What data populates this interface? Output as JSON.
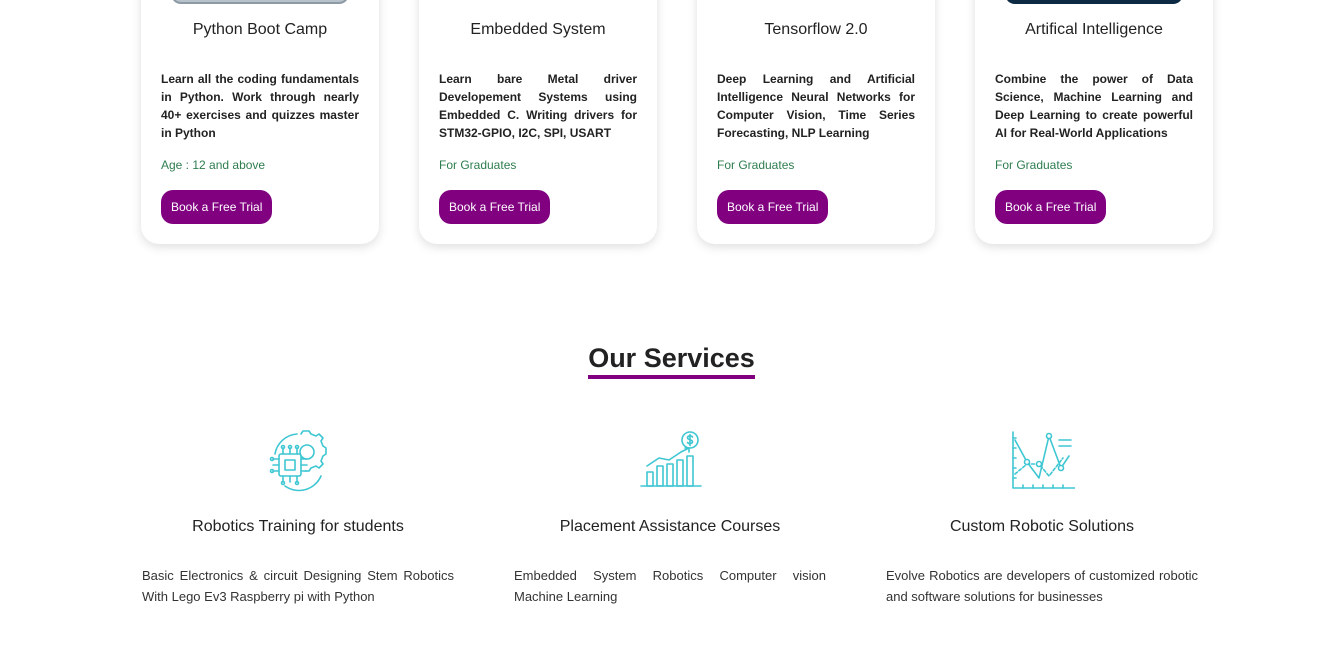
{
  "courses": [
    {
      "title": "Python Boot Camp",
      "description": "Learn all the coding fundamentals in Python. Work through nearly 40+ exercises and quizzes master in Python",
      "meta": "Age : 12 and above",
      "button": "Book a Free Trial",
      "image_color": "#b8c2cc"
    },
    {
      "title": "Embedded System",
      "description": "Learn bare Metal driver Developement Systems using Embedded C. Writing drivers for STM32-GPIO, I2C, SPI, USART",
      "meta": "For Graduates",
      "button": "Book a Free Trial",
      "image_color": "#ffffff"
    },
    {
      "title": "Tensorflow 2.0",
      "description": "Deep Learning and Artificial Intelligence Neural Networks for Computer Vision, Time Series Forecasting, NLP Learning",
      "meta": "For Graduates",
      "button": "Book a Free Trial",
      "image_color": "#ffffff"
    },
    {
      "title": "Artifical Intelligence",
      "description": "Combine the power of Data Science, Machine Learning and Deep Learning to create powerful AI for Real-World Applications",
      "meta": "For Graduates",
      "button": "Book a Free Trial",
      "image_color": "#0d2a44"
    }
  ],
  "services_section": {
    "title": "Our Services",
    "items": [
      {
        "icon": "gear-chip-icon",
        "title": "Robotics Training for students",
        "description": "Basic Electronics & circuit Designing Stem Robotics With Lego Ev3 Raspberry pi with Python"
      },
      {
        "icon": "growth-chart-dollar-icon",
        "title": "Placement Assistance Courses",
        "description": "Embedded System Robotics Computer vision Machine Learning"
      },
      {
        "icon": "line-graph-icon",
        "title": "Custom Robotic Solutions",
        "description": "Evolve Robotics are developers of customized robotic and software solutions for businesses"
      }
    ]
  },
  "colors": {
    "accent": "#800080",
    "icon": "#3ec6d2",
    "meta_text": "#2e7d4f"
  }
}
